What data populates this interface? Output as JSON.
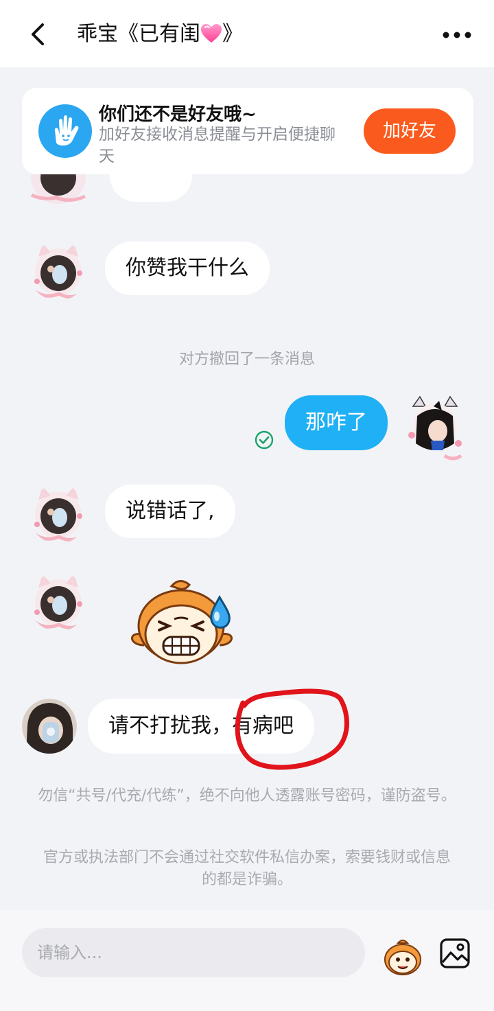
{
  "header": {
    "title": "乖宝《已有闺",
    "title_suffix": "》"
  },
  "friend_banner": {
    "title": "你们还不是好友哦~",
    "subtitle": "加好友接收消息提醒与开启便捷聊天",
    "button_label": "加好友"
  },
  "messages": {
    "m1": "你赞我干什么",
    "system_recall": "对方撤回了一条消息",
    "m2": "那咋了",
    "m3": "说错话了,",
    "m5": "请不打扰我，有病吧"
  },
  "notices": {
    "n1": "勿信“共号/代充/代练”，绝不向他人透露账号密码，谨防盗号。",
    "n2": "官方或执法部门不会通过社交软件私信办案，索要钱财或信息的都是诈骗。"
  },
  "input": {
    "placeholder": "请输入..."
  },
  "colors": {
    "accent_blue": "#1fb0f5",
    "add_button": "#fa5a1d",
    "read_check": "#1aa468",
    "annotation_red": "#e0141a"
  },
  "icons": [
    "back-icon",
    "heart-icon",
    "more-icon",
    "hand-icon",
    "read-check-icon",
    "sticker-icon",
    "image-icon"
  ]
}
